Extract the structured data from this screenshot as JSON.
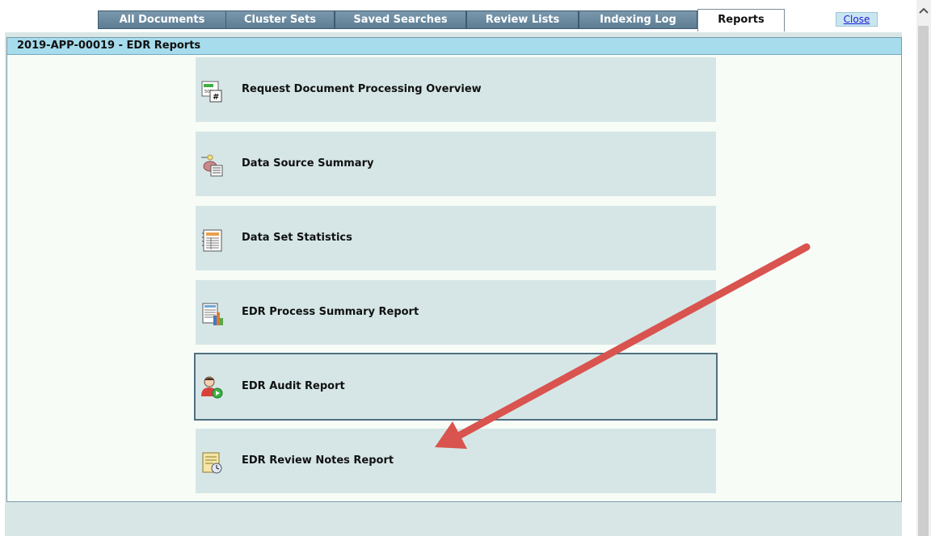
{
  "tabs": [
    {
      "label": "All Documents",
      "active": false
    },
    {
      "label": "Cluster Sets",
      "active": false
    },
    {
      "label": "Saved Searches",
      "active": false
    },
    {
      "label": "Review Lists",
      "active": false
    },
    {
      "label": "Indexing Log",
      "active": false
    },
    {
      "label": "Reports",
      "active": true
    }
  ],
  "close_label": "Close",
  "panel_title": "2019-APP-00019 - EDR Reports",
  "reports": [
    {
      "label": "Request Document Processing Overview",
      "icon": "processing-overview-icon"
    },
    {
      "label": "Data Source Summary",
      "icon": "data-source-icon"
    },
    {
      "label": "Data Set Statistics",
      "icon": "statistics-icon"
    },
    {
      "label": "EDR Process Summary Report",
      "icon": "process-summary-icon"
    },
    {
      "label": "EDR Audit Report",
      "icon": "audit-user-icon",
      "selected": true
    },
    {
      "label": "EDR Review Notes Report",
      "icon": "review-notes-icon"
    }
  ],
  "colors": {
    "tab_bg": "#6a8aa0",
    "header_bg": "#a6dcec",
    "card_bg": "#d6e6e6",
    "arrow": "#d9534f"
  }
}
